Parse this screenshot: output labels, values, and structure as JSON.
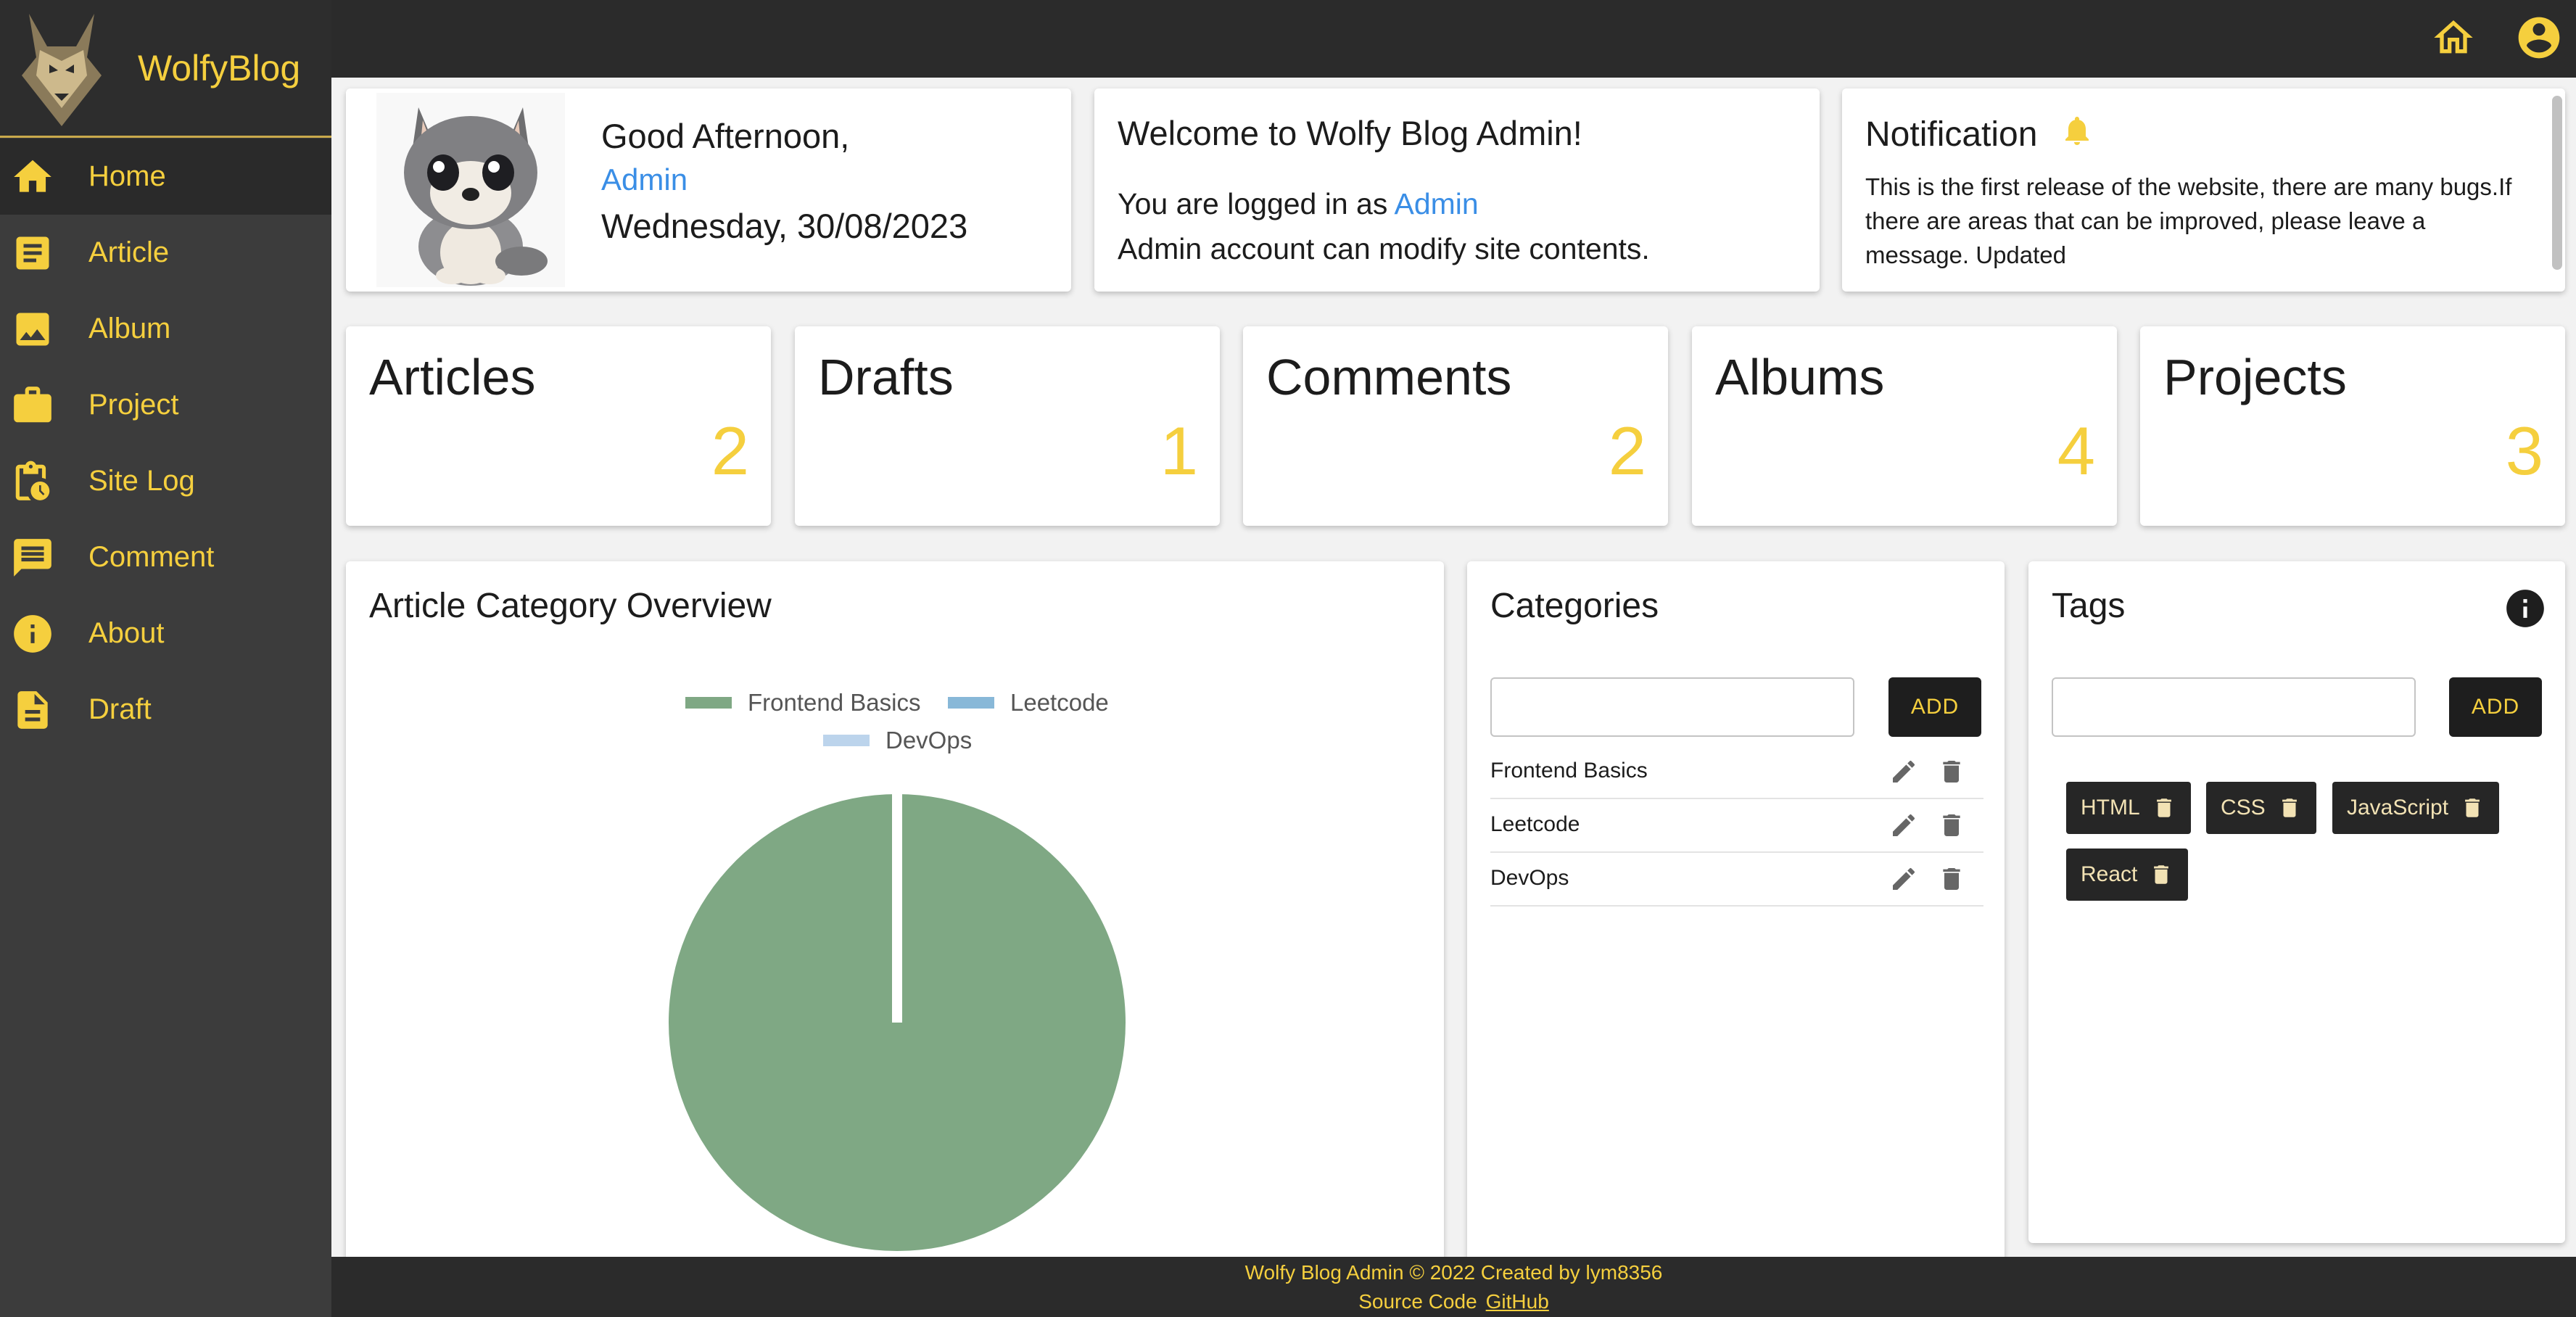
{
  "brand": {
    "name": "WolfyBlog"
  },
  "nav": [
    {
      "label": "Home",
      "icon": "home-icon",
      "active": true
    },
    {
      "label": "Article",
      "icon": "article-icon"
    },
    {
      "label": "Album",
      "icon": "image-icon"
    },
    {
      "label": "Project",
      "icon": "briefcase-icon"
    },
    {
      "label": "Site Log",
      "icon": "clipboard-clock-icon"
    },
    {
      "label": "Comment",
      "icon": "comment-icon"
    },
    {
      "label": "About",
      "icon": "info-icon"
    },
    {
      "label": "Draft",
      "icon": "draft-icon"
    }
  ],
  "topbar": {
    "icons": [
      "home-icon",
      "account-circle-icon"
    ]
  },
  "greeting": {
    "line1": "Good Afternoon,",
    "user": "Admin",
    "date": "Wednesday, 30/08/2023"
  },
  "welcome": {
    "title": "Welcome to Wolfy Blog Admin!",
    "logged_prefix": "You are logged in as",
    "logged_user": "Admin",
    "note": "Admin account can modify site contents."
  },
  "notification": {
    "title": "Notification",
    "text": "This is the first release of the website, there are many bugs.If there are areas that can be improved, please leave a message. Updated"
  },
  "stats": [
    {
      "title": "Articles",
      "value": "2"
    },
    {
      "title": "Drafts",
      "value": "1"
    },
    {
      "title": "Comments",
      "value": "2"
    },
    {
      "title": "Albums",
      "value": "4"
    },
    {
      "title": "Projects",
      "value": "3"
    }
  ],
  "overview": {
    "title": "Article Category Overview"
  },
  "chart_data": {
    "type": "pie",
    "categories": [
      "Frontend Basics",
      "Leetcode",
      "DevOps"
    ],
    "values": [
      2,
      0,
      0
    ],
    "colors": [
      "#7fa884",
      "#88b8d8",
      "#bcd4ec"
    ],
    "title": "",
    "legend": "top"
  },
  "categories": {
    "title": "Categories",
    "input_value": "",
    "add_label": "ADD",
    "items": [
      "Frontend Basics",
      "Leetcode",
      "DevOps"
    ]
  },
  "tags": {
    "title": "Tags",
    "input_value": "",
    "add_label": "ADD",
    "items": [
      "HTML",
      "CSS",
      "JavaScript",
      "React"
    ]
  },
  "footer": {
    "line1": "Wolfy Blog Admin © 2022 Created by lym8356",
    "source_label": "Source Code",
    "link_label": "GitHub"
  },
  "colors": {
    "accent": "#f5cf3e",
    "link": "#3a8ee6",
    "sidebar": "#3c3c3c",
    "topbar": "#2b2b2b"
  }
}
